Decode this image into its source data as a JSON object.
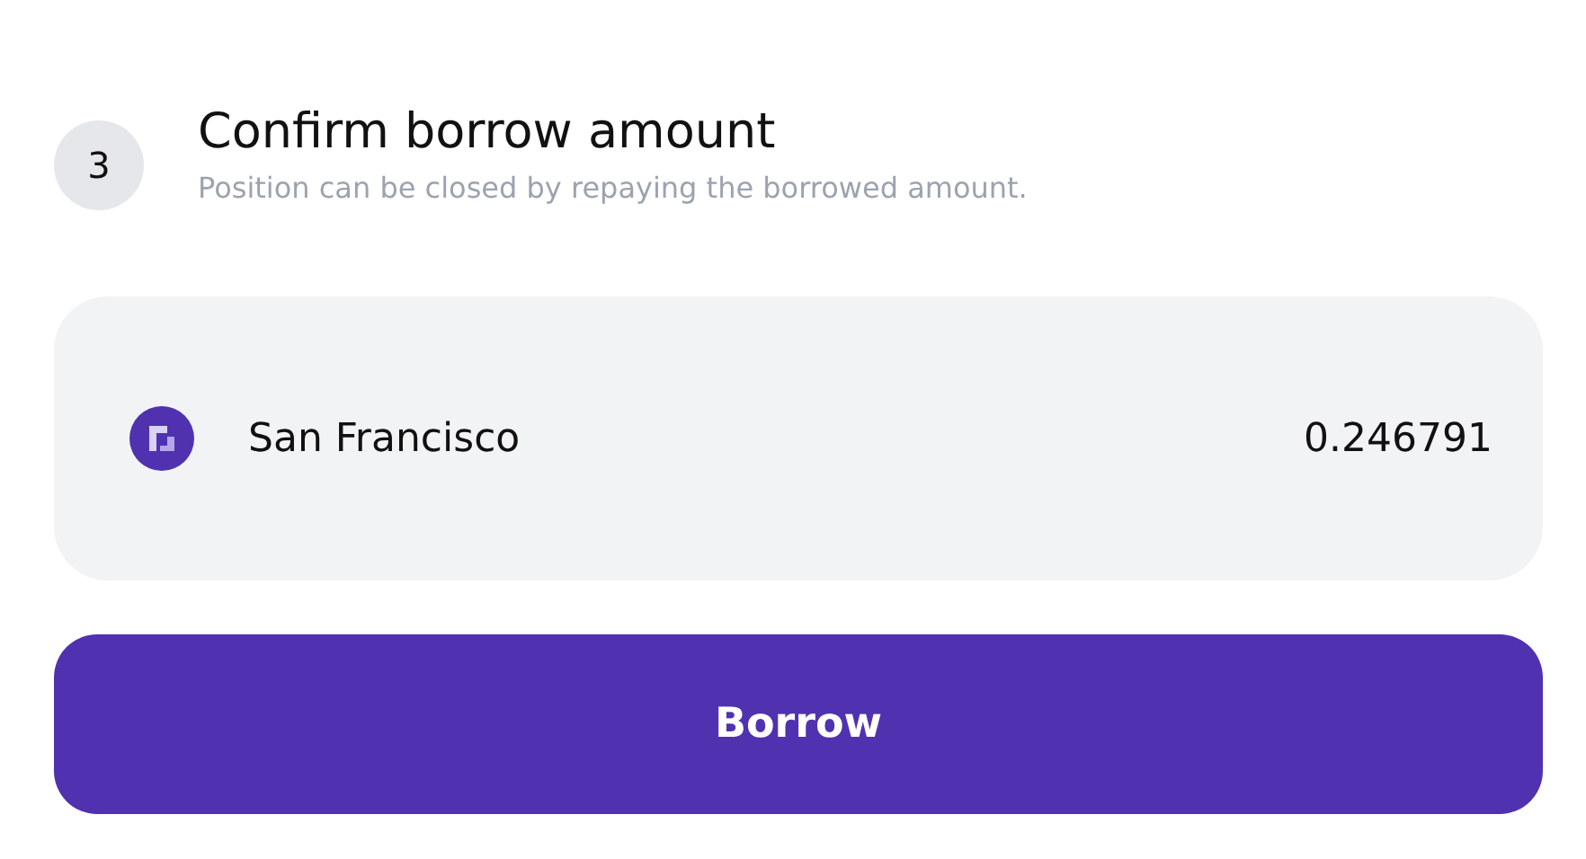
{
  "step": {
    "number": "3",
    "title": "Confirm borrow amount",
    "subtitle": "Position can be closed by repaying the borrowed amount."
  },
  "asset": {
    "name": "San Francisco",
    "amount": "0.246791"
  },
  "button": {
    "label": "Borrow"
  }
}
